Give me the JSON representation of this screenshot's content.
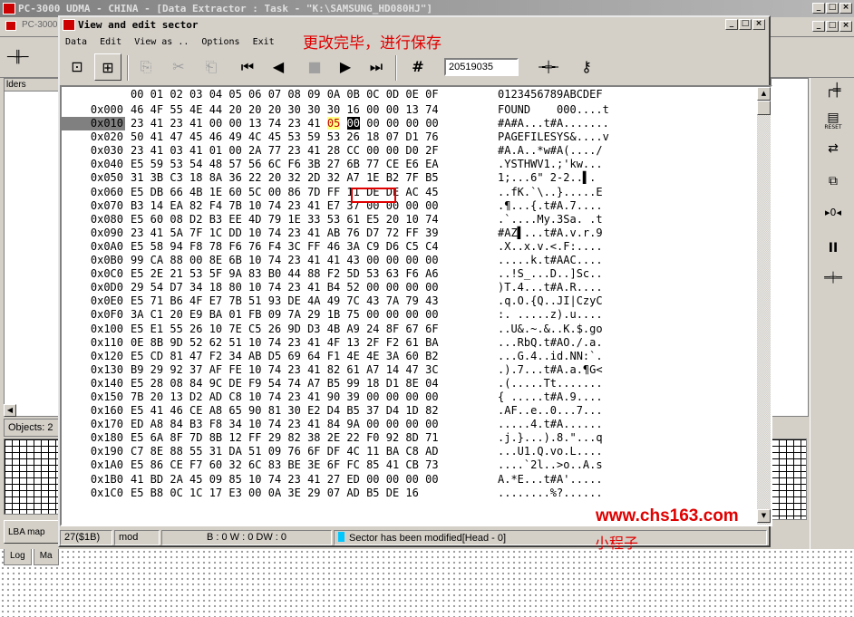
{
  "main_window": {
    "title": "PC-3000 UDMA - CHINA - [Data Extractor : Task - \"K:\\SAMSUNG_HD080HJ\"]",
    "doc_tab": "PC-3000",
    "folders_header": "lders",
    "objects_label": "Objects: 2",
    "lba_map_label": "LBA map",
    "bottom_tabs": [
      "Log",
      "Ma"
    ],
    "window_buttons": [
      "_",
      "□",
      "×"
    ]
  },
  "right_tools": [
    {
      "icon": "tree-branch-icon",
      "glyph": "┌╪"
    },
    {
      "icon": "reset-icon",
      "glyph": "▤",
      "caption": "RESET"
    },
    {
      "icon": "transfer-icon",
      "glyph": "⇄"
    },
    {
      "icon": "copy-icon",
      "glyph": "⧉"
    },
    {
      "icon": "zero-fill-icon",
      "glyph": "▸0◂"
    },
    {
      "icon": "pause-icon",
      "glyph": "II"
    },
    {
      "icon": "step-icon",
      "glyph": "═╪═"
    }
  ],
  "dialog": {
    "title": "View and edit sector",
    "window_buttons": [
      "_",
      "□",
      "×"
    ],
    "menu": [
      "Data",
      "Edit",
      "View as ..",
      "Options",
      "Exit"
    ],
    "annotation": "更改完毕，进行保存",
    "toolbar": {
      "sector_value": "20519035",
      "buttons": [
        {
          "name": "open-icon",
          "glyph": "⊡"
        },
        {
          "name": "save-icon",
          "glyph": "⊞"
        },
        {
          "name": "copy-icon",
          "glyph": "⎘"
        },
        {
          "name": "cut-icon",
          "glyph": "✂"
        },
        {
          "name": "paste-icon",
          "glyph": "⎗"
        },
        {
          "name": "first-sector-icon",
          "glyph": "⏮"
        },
        {
          "name": "prev-sector-icon",
          "glyph": "◀"
        },
        {
          "name": "stop-icon",
          "glyph": "■"
        },
        {
          "name": "next-sector-icon",
          "glyph": "▶"
        },
        {
          "name": "last-sector-icon",
          "glyph": "⏭"
        },
        {
          "name": "goto-sector-icon",
          "glyph": "#"
        },
        {
          "name": "compare-icon",
          "glyph": "╼╪╾"
        },
        {
          "name": "key-icon",
          "glyph": "⚷"
        }
      ]
    },
    "hex_header_bytes": "00 01 02 03 04 05 06 07 08 09 0A 0B 0C 0D 0E 0F",
    "hex_header_ascii": "0123456789ABCDEF",
    "rows": [
      {
        "addr": "0x000",
        "bytes": "46 4F 55 4E 44 20 20 20 30 30 30 16 00 00 13 74",
        "ascii": "FOUND    000....t"
      },
      {
        "addr": "0x010",
        "bytes": "23 41 23 41 00 00 13 74 23 41 05 00 00 00 00 00",
        "ascii": "#A#A...t#A.......",
        "selected": true
      },
      {
        "addr": "0x020",
        "bytes": "50 41 47 45 46 49 4C 45 53 59 53 26 18 07 D1 76",
        "ascii": "PAGEFILESYS&....v"
      },
      {
        "addr": "0x030",
        "bytes": "23 41 03 41 01 00 2A 77 23 41 28 CC 00 00 D0 2F",
        "ascii": "#A.A..*w#A(..../"
      },
      {
        "addr": "0x040",
        "bytes": "E5 59 53 54 48 57 56 6C F6 3B 27 6B 77 CE E6 EA",
        "ascii": ".YSTHWV1.;'kw..."
      },
      {
        "addr": "0x050",
        "bytes": "31 3B C3 18 8A 36 22 20 32 2D 32 A7 1E B2 7F B5",
        "ascii": "1;...6\" 2-2..▌."
      },
      {
        "addr": "0x060",
        "bytes": "E5 DB 66 4B 1E 60 5C 00 86 7D FF 11 DE DE AC 45",
        "ascii": "..fK.`\\..}.....E"
      },
      {
        "addr": "0x070",
        "bytes": "B3 14 EA 82 F4 7B 10 74 23 41 E7 37 00 00 00 00",
        "ascii": ".¶...{.t#A.7...."
      },
      {
        "addr": "0x080",
        "bytes": "E5 60 08 D2 B3 EE 4D 79 1E 33 53 61 E5 20 10 74",
        "ascii": ".`....My.3Sa. .t"
      },
      {
        "addr": "0x090",
        "bytes": "23 41 5A 7F 1C DD 10 74 23 41 AB 76 D7 72 FF 39",
        "ascii": "#AZ▌...t#A.v.r.9"
      },
      {
        "addr": "0x0A0",
        "bytes": "E5 58 94 F8 78 F6 76 F4 3C FF 46 3A C9 D6 C5 C4",
        "ascii": ".X..x.v.<.F:...."
      },
      {
        "addr": "0x0B0",
        "bytes": "99 CA 88 00 8E 6B 10 74 23 41 41 43 00 00 00 00",
        "ascii": ".....k.t#AAC...."
      },
      {
        "addr": "0x0C0",
        "bytes": "E5 2E 21 53 5F 9A 83 B0 44 88 F2 5D 53 63 F6 A6",
        "ascii": "..!S_...D..]Sc.."
      },
      {
        "addr": "0x0D0",
        "bytes": "29 54 D7 34 18 80 10 74 23 41 B4 52 00 00 00 00",
        "ascii": ")T.4...t#A.R...."
      },
      {
        "addr": "0x0E0",
        "bytes": "E5 71 B6 4F E7 7B 51 93 DE 4A 49 7C 43 7A 79 43",
        "ascii": ".q.O.{Q..JI|CzyC"
      },
      {
        "addr": "0x0F0",
        "bytes": "3A C1 20 E9 BA 01 FB 09 7A 29 1B 75 00 00 00 00",
        "ascii": ":. .....z).u...."
      },
      {
        "addr": "0x100",
        "bytes": "E5 E1 55 26 10 7E C5 26 9D D3 4B A9 24 8F 67 6F",
        "ascii": "..U&.~.&..K.$.go"
      },
      {
        "addr": "0x110",
        "bytes": "0E 8B 9D 52 62 51 10 74 23 41 4F 13 2F F2 61 BA",
        "ascii": "...RbQ.t#AO./.a."
      },
      {
        "addr": "0x120",
        "bytes": "E5 CD 81 47 F2 34 AB D5 69 64 F1 4E 4E 3A 60 B2",
        "ascii": "...G.4..id.NN:`."
      },
      {
        "addr": "0x130",
        "bytes": "B9 29 92 37 AF FE 10 74 23 41 82 61 A7 14 47 3C",
        "ascii": ".).7...t#A.a.¶G<"
      },
      {
        "addr": "0x140",
        "bytes": "E5 28 08 84 9C DE F9 54 74 A7 B5 99 18 D1 8E 04",
        "ascii": ".(.....Tt......."
      },
      {
        "addr": "0x150",
        "bytes": "7B 20 13 D2 AD C8 10 74 23 41 90 39 00 00 00 00",
        "ascii": "{ .....t#A.9...."
      },
      {
        "addr": "0x160",
        "bytes": "E5 41 46 CE A8 65 90 81 30 E2 D4 B5 37 D4 1D 82",
        "ascii": ".AF..e..0...7..."
      },
      {
        "addr": "0x170",
        "bytes": "ED A8 84 B3 F8 34 10 74 23 41 84 9A 00 00 00 00",
        "ascii": ".....4.t#A......"
      },
      {
        "addr": "0x180",
        "bytes": "E5 6A 8F 7D 8B 12 FF 29 82 38 2E 22 F0 92 8D 71",
        "ascii": ".j.}...).8.\"...q"
      },
      {
        "addr": "0x190",
        "bytes": "C7 8E 88 55 31 DA 51 09 76 6F DF 4C 11 BA C8 AD",
        "ascii": "...U1.Q.vo.L...."
      },
      {
        "addr": "0x1A0",
        "bytes": "E5 86 CE F7 60 32 6C 83 BE 3E 6F FC 85 41 CB 73",
        "ascii": "....`2l..>o..A.s"
      },
      {
        "addr": "0x1B0",
        "bytes": "41 BD 2A 45 09 85 10 74 23 41 27 ED 00 00 00 00",
        "ascii": "A.*E...t#A'....."
      },
      {
        "addr": "0x1C0",
        "bytes": "E5 B8 0C 1C 17 E3 00 0A 3E 29 07 AD B5 DE 16",
        "ascii": "........%?......"
      }
    ],
    "status": {
      "position": "27($1B)",
      "mode": "mod",
      "byte_info": "B : 0 W : 0 DW : 0",
      "message": "Sector has been modified[Head - 0]"
    }
  },
  "watermark": {
    "url": "www.chs163.com",
    "sub": "小程子"
  },
  "colors": {
    "annotation_red": "#e00000",
    "status_flag": "#00c8ff",
    "window_face": "#d4d0c8"
  }
}
